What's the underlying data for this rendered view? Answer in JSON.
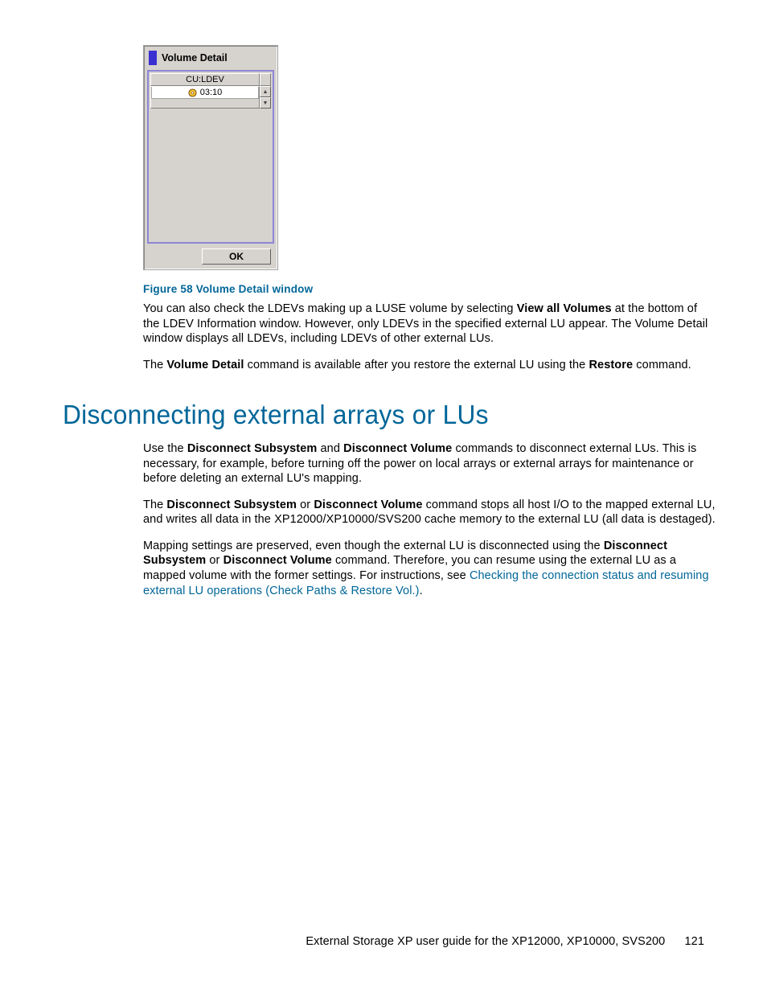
{
  "volume_detail": {
    "title": "Volume Detail",
    "column_header": "CU:LDEV",
    "rows": [
      "03:10"
    ],
    "ok_label": "OK",
    "scroll_up_glyph": "▲",
    "scroll_down_glyph": "▼"
  },
  "figure_caption": "Figure 58 Volume Detail window",
  "para1": {
    "t1": "You can also check the LDEVs making up a LUSE volume by selecting ",
    "b1": "View all Volumes",
    "t2": " at the bottom of the LDEV Information window. However, only LDEVs in the specified external LU appear. The Volume Detail window displays all LDEVs, including LDEVs of other external LUs."
  },
  "para2": {
    "t1": "The ",
    "b1": "Volume Detail",
    "t2": " command is available after you restore the external LU using the ",
    "b2": "Restore",
    "t3": " command."
  },
  "section_heading": "Disconnecting external arrays or LUs",
  "para3": {
    "t1": "Use the ",
    "b1": "Disconnect Subsystem",
    "t2": " and ",
    "b2": "Disconnect Volume",
    "t3": " commands to disconnect external LUs. This is necessary, for example, before turning off the power on local arrays or external arrays for maintenance or before deleting an external LU's mapping."
  },
  "para4": {
    "t1": "The ",
    "b1": "Disconnect Subsystem",
    "t2": " or ",
    "b2": "Disconnect Volume",
    "t3": " command stops all host I/O to the mapped external LU, and writes all data in the XP12000/XP10000/SVS200 cache memory to the external LU (all data is destaged)."
  },
  "para5": {
    "t1": "Mapping settings are preserved, even though the external LU is disconnected using the ",
    "b1": "Disconnect Subsystem",
    "t2": " or ",
    "b2": "Disconnect Volume",
    "t3": " command. Therefore, you can resume using the external LU as a mapped volume with the former settings. For instructions, see ",
    "link": "Checking the connection status and resuming external LU operations (Check Paths & Restore Vol.)",
    "t4": "."
  },
  "footer": {
    "text": "External Storage XP user guide for the XP12000, XP10000, SVS200",
    "page": "121"
  }
}
